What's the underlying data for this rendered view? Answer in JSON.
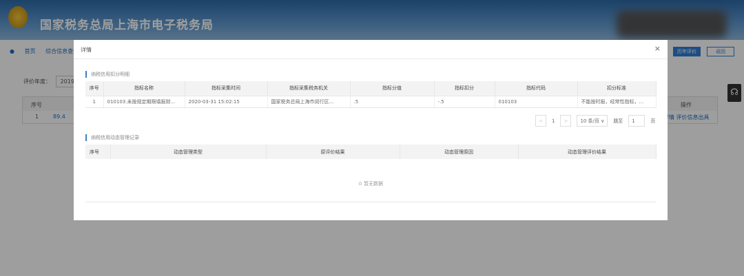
{
  "header": {
    "title": "国家税务总局上海市电子税务局"
  },
  "breadcrumb": [
    "首页",
    "综合信息查询"
  ],
  "filter": {
    "label": "评价年度：",
    "value": "2019"
  },
  "toolbar": {
    "primary_label": "历年评价",
    "back_label": "返回"
  },
  "bg_table": {
    "headers": [
      "序号",
      "操作"
    ],
    "row": {
      "index": "1",
      "score": "89.4",
      "actions": "详情 评价信息出具"
    }
  },
  "modal": {
    "title": "详情",
    "close": "×",
    "section1": {
      "title": "纳税信用扣分明细",
      "headers": [
        "序号",
        "指标名称",
        "指标采集时间",
        "指标采集税务机关",
        "指标分值",
        "指标扣分",
        "指标代码",
        "扣分标准"
      ],
      "rows": [
        [
          "1",
          "010103.未按规定期限填报财...",
          "2020-03-31 15:02:15",
          "国家税务总局上海市闵行区...",
          ".5",
          "-.5",
          "010103",
          "不能按时报，经常性指标，..."
        ]
      ]
    },
    "pagination": {
      "prev": "<",
      "page": "1",
      "next": ">",
      "page_size": "10 条/页 ∨",
      "goto_label": "跳至",
      "goto_value": "1",
      "page_suffix": "页"
    },
    "section2": {
      "title": "纳税信用动态管理记录",
      "headers": [
        "序号",
        "动态管理类型",
        "原评价结果",
        "动态管理原因",
        "动态管理评价结果"
      ],
      "empty": "暂无数据"
    }
  }
}
